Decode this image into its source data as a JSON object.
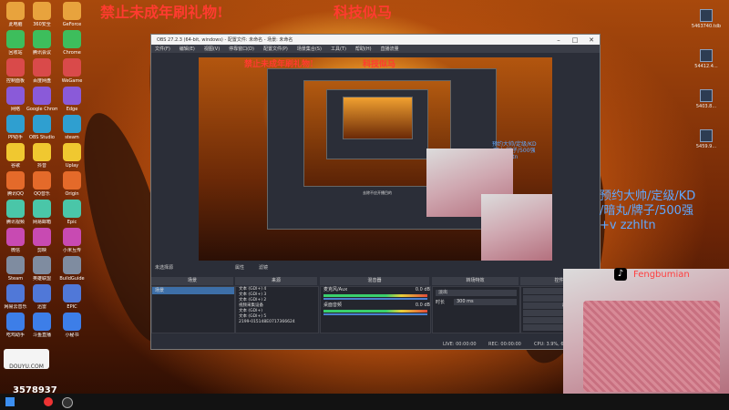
{
  "overlay": {
    "warning_text": "禁止未成年刷礼物!",
    "channel_text": "科技似马",
    "promo_text": "预约大帅/定级/KD\n/暗丸/牌子/500强\n+v zzhltn",
    "tiktok_name": "Fengbumian",
    "logo_text": "DOUYU.COM",
    "viewer_count": "3578937"
  },
  "desktop": {
    "icons_col1": [
      "此电脑",
      "回收站",
      "控制面板",
      "网络",
      "PP助手",
      "谷歌",
      "腾讯QQ",
      "腾讯视频",
      "微信",
      "Steam",
      "网易云音乐",
      "吃鸡助手"
    ],
    "icons_col2": [
      "360安全",
      "腾讯会议",
      "百度网盘",
      "Google Chrome",
      "OBS Studio",
      "抖音",
      "QQ音乐",
      "网易邮箱",
      "剪映",
      "英雄联盟",
      "迅雷",
      "斗鱼直播"
    ],
    "icons_col3": [
      "GeForce",
      "Chrome",
      "WeGame",
      "Edge",
      "steam",
      "Uplay",
      "Origin",
      "Epic",
      "小米互传",
      "BuildGuide",
      "EPIC",
      "小秘书"
    ],
    "right_files": [
      "5463740.tdb",
      "54412.4...",
      "5403.8...",
      "5459.9..."
    ]
  },
  "obs": {
    "title": "OBS 27.2.3 (64-bit, windows) - 配置文件: 未命名 - 场景: 未命名",
    "menu": [
      "文件(F)",
      "编辑(E)",
      "视图(V)",
      "停靠窗口(D)",
      "配置文件(P)",
      "场景集合(S)",
      "工具(T)",
      "帮助(H)",
      "直播流量"
    ],
    "toolbar_labels": {
      "scene_filter": "未选择源",
      "properties": "属性",
      "filters": "滤镜"
    },
    "docks": {
      "scenes": "场景",
      "sources": "来源",
      "mixer": "混音器",
      "transitions": "转场特效",
      "controls": "控件"
    },
    "scenes": [
      "场景"
    ],
    "sources": [
      "文本 (GDI+) 4",
      "文本 (GDI+) 3",
      "文本 (GDI+) 2",
      "视频采集设备",
      "文本 (GDI+)",
      "文本 (GDI+) 5",
      "2199-015148E0717366624"
    ],
    "mixer": [
      {
        "name": "麦克风/Aux",
        "db": "0.0 dB"
      },
      {
        "name": "桌面音频",
        "db": "0.0 dB"
      }
    ],
    "transition": {
      "type": "淡出",
      "duration_label": "时长",
      "duration": "300 ms"
    },
    "controls": [
      "停止推流",
      "开始录制",
      "启动虚拟摄像机",
      "工作室模式",
      "设置",
      "退出"
    ],
    "status": {
      "live": "LIVE: 00:00:00",
      "rec": "REC: 00:00:00",
      "cpu": "CPU: 3.9%, 60.00 fps"
    },
    "nested_title": "去除不应开播目的"
  },
  "colors": {
    "accent": "#3d6fa8",
    "warning": "#ff3b30",
    "promo": "#5fa8ff"
  }
}
